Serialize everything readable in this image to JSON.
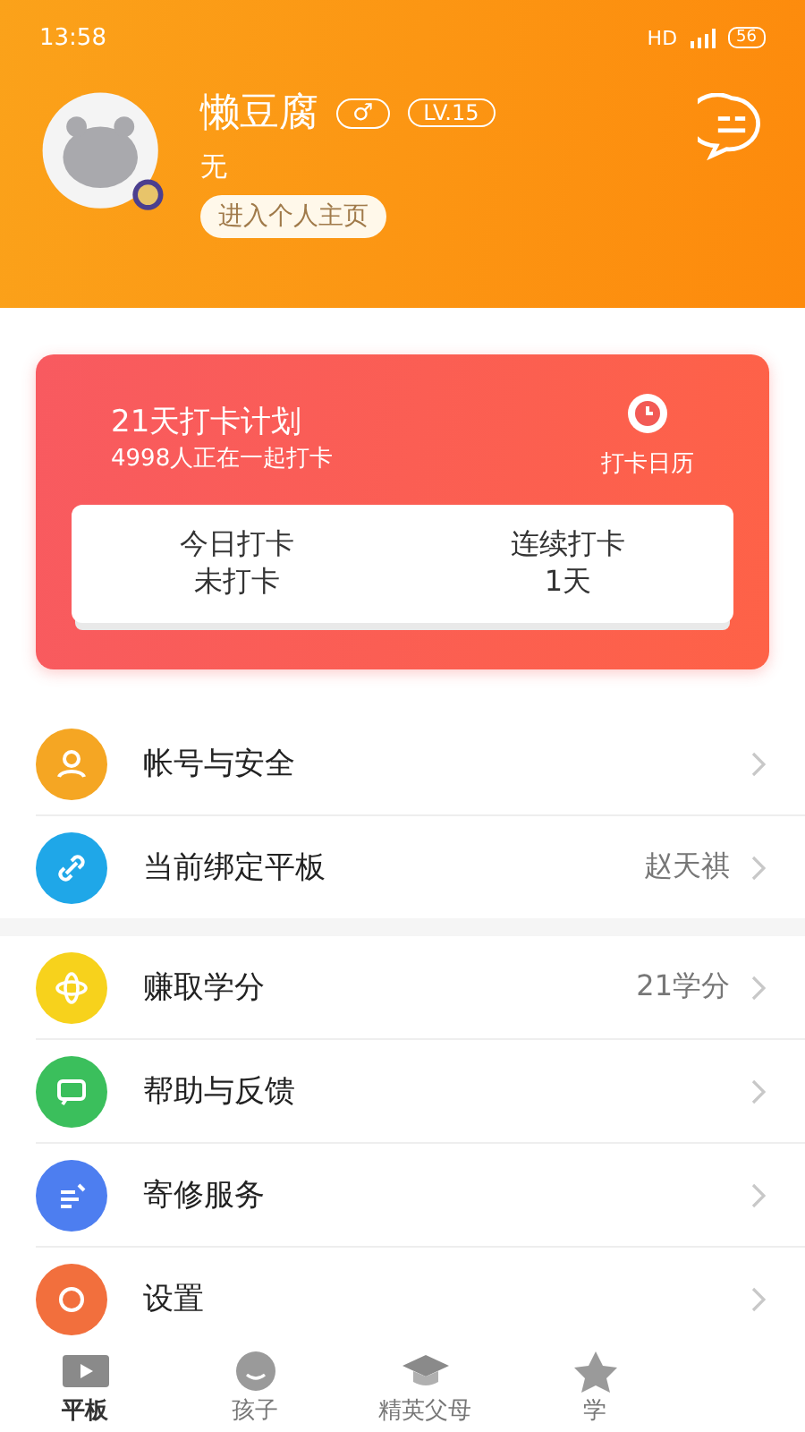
{
  "status_bar": {
    "time": "13:58",
    "network": "HD",
    "battery": "56"
  },
  "profile": {
    "name": "懒豆腐",
    "gender": "♂",
    "level": "LV.15",
    "signature": "无",
    "home_link": "进入个人主页"
  },
  "checkin": {
    "title": "21天打卡计划",
    "subtitle": "4998人正在一起打卡",
    "calendar": "打卡日历",
    "stats": [
      {
        "label": "今日打卡",
        "value": "未打卡"
      },
      {
        "label": "连续打卡",
        "value": "1天"
      }
    ]
  },
  "menu_groups": [
    [
      {
        "color": "#f5a623",
        "label": "帐号与安全"
      },
      {
        "color": "#1fa7e8",
        "label": "当前绑定平板",
        "value": "赵天祺"
      }
    ],
    [
      {
        "color": "#f7d21c",
        "label": "赚取学分",
        "value": "21学分"
      },
      {
        "color": "#3bbf5c",
        "label": "帮助与反馈"
      },
      {
        "color": "#4d7ef0",
        "label": "寄修服务"
      },
      {
        "color": "#f26f3d",
        "label": "设置"
      }
    ]
  ],
  "tabs": [
    {
      "label": "平板",
      "selected": true
    },
    {
      "label": "孩子",
      "selected": false
    },
    {
      "label": "精英父母",
      "selected": false
    },
    {
      "label": "学",
      "selected": false
    }
  ]
}
